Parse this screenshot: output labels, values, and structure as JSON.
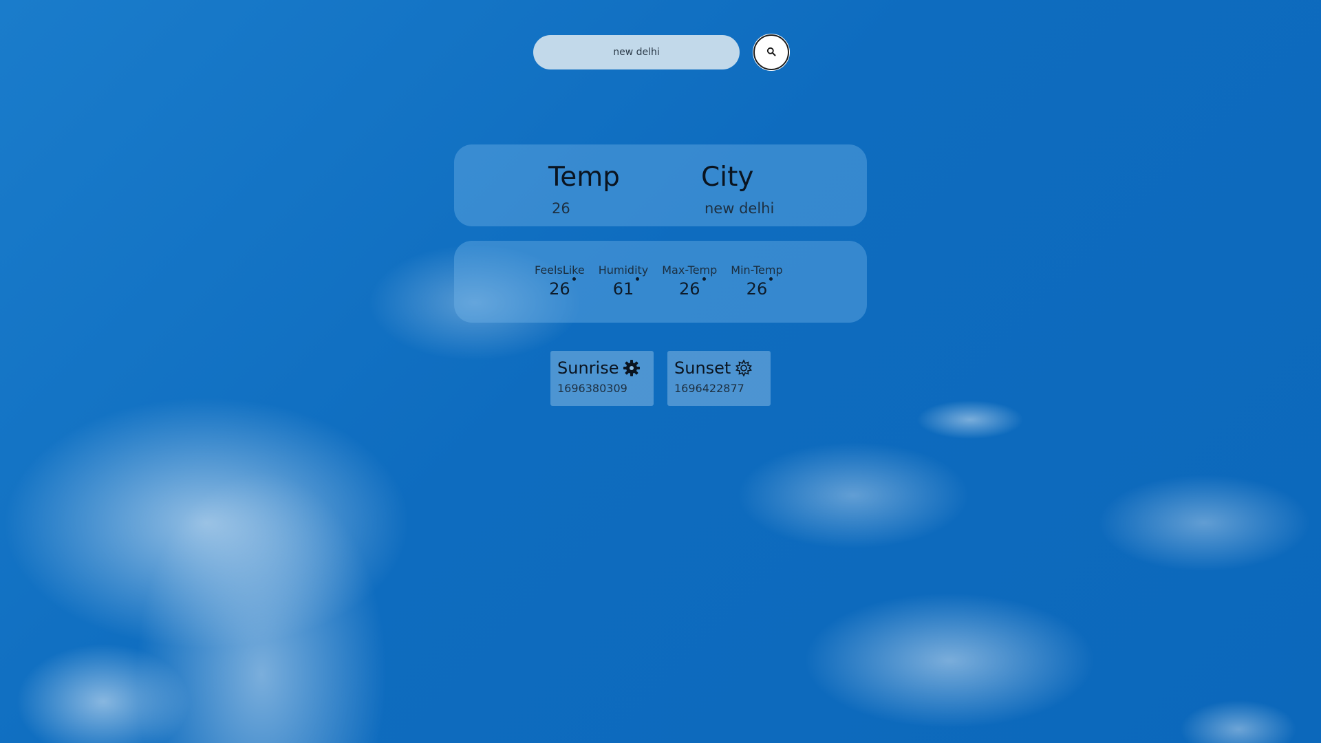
{
  "search": {
    "value": "new delhi",
    "placeholder": "new delhi",
    "button_icon": "search-icon"
  },
  "main": {
    "temp_heading": "Temp",
    "temp_value": "26",
    "city_heading": "City",
    "city_value": "new delhi"
  },
  "stats": [
    {
      "label": "FeelsLike",
      "value": "26"
    },
    {
      "label": "Humidity",
      "value": "61"
    },
    {
      "label": "Max-Temp",
      "value": "26"
    },
    {
      "label": "Min-Temp",
      "value": "26"
    }
  ],
  "sun": {
    "sunrise_label": "Sunrise",
    "sunrise_value": "1696380309",
    "sunrise_icon": "sun-gear-filled-icon",
    "sunset_label": "Sunset",
    "sunset_value": "1696422877",
    "sunset_icon": "sun-gear-outline-icon"
  },
  "colors": {
    "sky": "#0e6cbf",
    "search_bg": "#c2d9ea"
  }
}
